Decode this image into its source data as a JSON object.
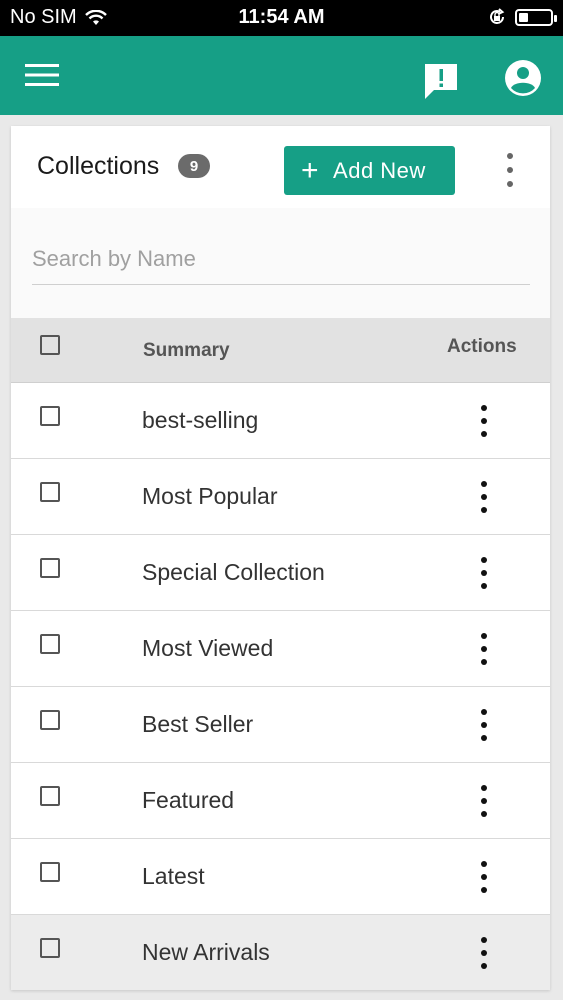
{
  "status_bar": {
    "carrier": "No SIM",
    "time": "11:54 AM",
    "battery_level": 0.3,
    "icons": [
      "wifi-icon",
      "rotation-lock-icon",
      "battery-icon"
    ]
  },
  "app_bar": {
    "color": "#169f86",
    "icons": [
      "menu-icon",
      "feedback-icon",
      "account-icon"
    ]
  },
  "header": {
    "title": "Collections",
    "count": "9",
    "add_button_label": "Add New",
    "add_button_icon": "plus-icon",
    "more_icon": "more-vertical-icon"
  },
  "search": {
    "placeholder": "Search by Name",
    "value": ""
  },
  "table": {
    "columns": [
      "Summary",
      "Actions"
    ],
    "rows": [
      {
        "label": "best-selling"
      },
      {
        "label": "Most Popular"
      },
      {
        "label": "Special Collection"
      },
      {
        "label": "Most Viewed"
      },
      {
        "label": "Best Seller"
      },
      {
        "label": "Featured"
      },
      {
        "label": "Latest"
      },
      {
        "label": "New Arrivals"
      }
    ]
  },
  "colors": {
    "accent": "#169f86",
    "badge": "#6b6b6b",
    "header_bg": "#e2e2e2"
  }
}
